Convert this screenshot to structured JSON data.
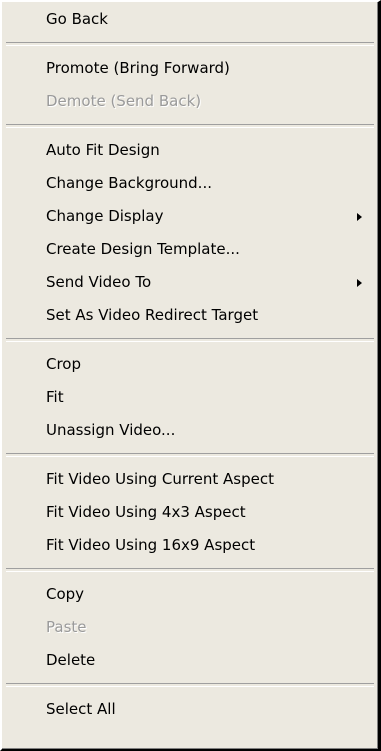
{
  "menu": {
    "go_back": "Go Back",
    "promote": "Promote (Bring Forward)",
    "demote": "Demote (Send Back)",
    "auto_fit_design": "Auto Fit Design",
    "change_background": "Change Background...",
    "change_display": "Change Display",
    "create_design_template": "Create Design Template...",
    "send_video_to": "Send Video To",
    "set_video_redirect": "Set As Video Redirect Target",
    "crop": "Crop",
    "fit": "Fit",
    "unassign_video": "Unassign Video...",
    "fit_current_aspect": "Fit Video Using Current Aspect",
    "fit_4x3": "Fit Video Using 4x3 Aspect",
    "fit_16x9": "Fit Video Using 16x9 Aspect",
    "copy": "Copy",
    "paste": "Paste",
    "delete": "Delete",
    "select_all": "Select All"
  },
  "icons": {
    "submenu_arrow": "submenu-arrow-icon"
  },
  "colors": {
    "menu_background": "#ece9e0",
    "disabled_text": "#9a9a9a"
  }
}
